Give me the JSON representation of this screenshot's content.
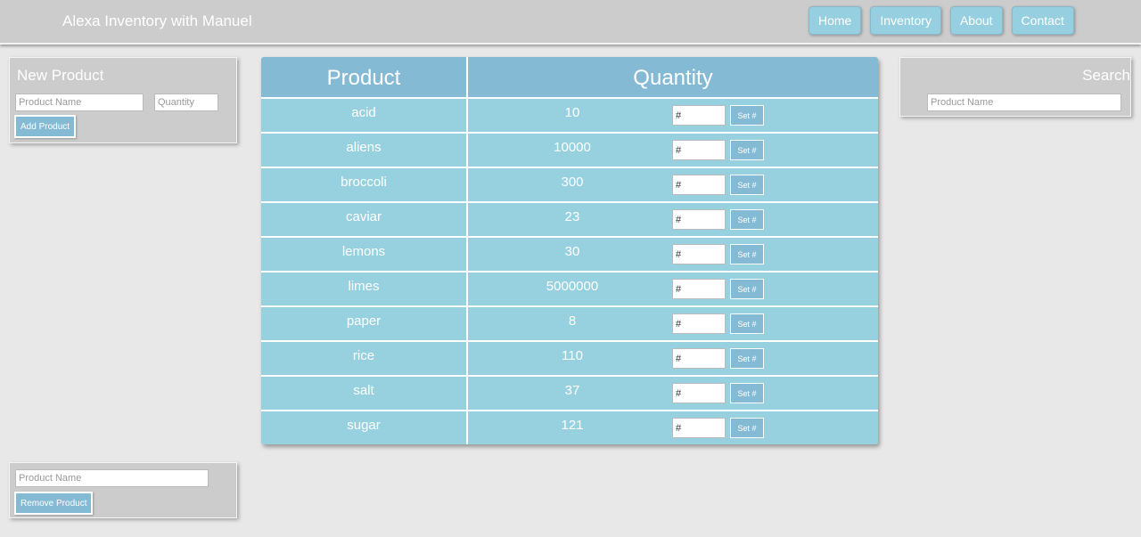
{
  "header": {
    "title": "Alexa Inventory with Manuel",
    "nav": [
      "Home",
      "Inventory",
      "About",
      "Contact"
    ]
  },
  "new_product": {
    "title": "New Product",
    "name_placeholder": "Product Name",
    "qty_placeholder": "Quantity",
    "add_label": "Add Product"
  },
  "search": {
    "title": "Search",
    "placeholder": "Product Name"
  },
  "remove": {
    "placeholder": "Product Name",
    "remove_label": "Remove Product"
  },
  "table": {
    "headers": [
      "Product",
      "Quantity"
    ],
    "set_placeholder": "#",
    "set_label": "Set #",
    "rows": [
      {
        "name": "acid",
        "qty": "10"
      },
      {
        "name": "aliens",
        "qty": "10000"
      },
      {
        "name": "broccoli",
        "qty": "300"
      },
      {
        "name": "caviar",
        "qty": "23"
      },
      {
        "name": "lemons",
        "qty": "30"
      },
      {
        "name": "limes",
        "qty": "5000000"
      },
      {
        "name": "paper",
        "qty": "8"
      },
      {
        "name": "rice",
        "qty": "110"
      },
      {
        "name": "salt",
        "qty": "37"
      },
      {
        "name": "sugar",
        "qty": "121"
      }
    ]
  },
  "colors": {
    "header_bg": "#cccccc",
    "nav_button": "#96cfdf",
    "table_header": "#85bad5",
    "table_row": "#97d1df",
    "page_bg": "#e8e8e8"
  }
}
